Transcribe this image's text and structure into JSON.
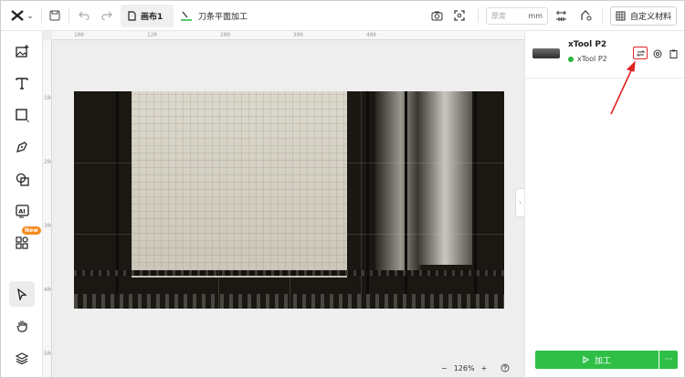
{
  "topbar": {
    "logo_icon": "xtool-logo",
    "doc_tab_label": "画布1",
    "mode_label": "刀条平面加工",
    "thickness_placeholder": "厚度",
    "unit": "mm",
    "custom_material_label": "自定义材料"
  },
  "leftbar": {
    "tools": [
      "image-icon",
      "text-icon",
      "shape-icon",
      "pen-icon",
      "combine-icon",
      "ai-icon",
      "apps-icon",
      "select-icon",
      "hand-icon",
      "layers-icon"
    ],
    "new_badge": "New",
    "ai_label": "AI"
  },
  "canvas": {
    "ruler_top_ticks": [
      "100",
      "120",
      "200",
      "300",
      "400"
    ],
    "ruler_left_ticks": [
      "100",
      "200",
      "300",
      "400",
      "500"
    ],
    "zoom_minus": "−",
    "zoom_level": "126%",
    "zoom_plus": "+"
  },
  "rightpanel": {
    "device_name": "xTool P2",
    "device_status": "xTool P2",
    "status_color": "#28b43b",
    "process_label": "加工",
    "more_label": "···"
  },
  "colors": {
    "accent_green": "#2fbf47",
    "highlight_red": "#e02424",
    "new_badge": "#f58a1f"
  }
}
